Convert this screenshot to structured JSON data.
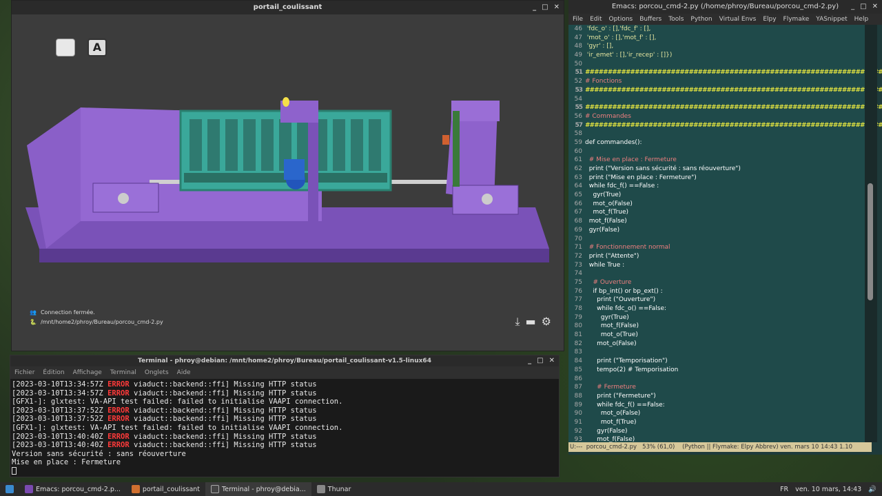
{
  "viewer": {
    "title": "portail_coulissant",
    "status": "Connection fermée.",
    "path": "/mnt/home2/phroy/Bureau/porcou_cmd-2.py",
    "btn_a": "A"
  },
  "emacs": {
    "title": "Emacs: porcou_cmd-2.py (/home/phroy/Bureau/porcou_cmd-2.py)",
    "menu": [
      "File",
      "Edit",
      "Options",
      "Buffers",
      "Tools",
      "Python",
      "Virtual Envs",
      "Elpy",
      "Flymake",
      "YASnippet",
      "Help"
    ],
    "lines": [
      {
        "n": "46",
        "t": " 'fdc_o' : [],'fdc_f' : [],",
        "c": "str"
      },
      {
        "n": "47",
        "t": " 'mot_o' : [],'mot_f' : [],",
        "c": "str"
      },
      {
        "n": "48",
        "t": " 'gyr' : [],",
        "c": "str"
      },
      {
        "n": "49",
        "t": " 'ir_emet' : [],'ir_recep' : []})",
        "c": "str"
      },
      {
        "n": "50",
        "t": "",
        "c": ""
      },
      {
        "n": "51",
        "t": "##################################################################",
        "c": "hash"
      },
      {
        "n": "52",
        "t": "# Fonctions",
        "c": "comment"
      },
      {
        "n": "53",
        "t": "##################################################################",
        "c": "hash"
      },
      {
        "n": "54",
        "t": "",
        "c": ""
      },
      {
        "n": "55",
        "t": "##################################################################",
        "c": "hash"
      },
      {
        "n": "56",
        "t": "# Commandes",
        "c": "comment"
      },
      {
        "n": "57",
        "t": "##################################################################",
        "c": "hash"
      },
      {
        "n": "58",
        "t": "",
        "c": ""
      },
      {
        "n": "59",
        "t": "def commandes():",
        "c": "kw"
      },
      {
        "n": "60",
        "t": "",
        "c": ""
      },
      {
        "n": "61",
        "t": "  # Mise en place : Fermeture",
        "c": "comment"
      },
      {
        "n": "62",
        "t": "  print (\"Version sans sécurité : sans réouverture\")",
        "c": "kw"
      },
      {
        "n": "63",
        "t": "  print (\"Mise en place : Fermeture\")",
        "c": "kw"
      },
      {
        "n": "64",
        "t": "  while fdc_f() ==False :",
        "c": "kw"
      },
      {
        "n": "65",
        "t": "    gyr(True)",
        "c": "kw"
      },
      {
        "n": "66",
        "t": "    mot_o(False)",
        "c": "kw"
      },
      {
        "n": "67",
        "t": "    mot_f(True)",
        "c": "kw"
      },
      {
        "n": "68",
        "t": "  mot_f(False)",
        "c": "kw"
      },
      {
        "n": "69",
        "t": "  gyr(False)",
        "c": "kw"
      },
      {
        "n": "70",
        "t": "",
        "c": ""
      },
      {
        "n": "71",
        "t": "  # Fonctionnement normal",
        "c": "comment"
      },
      {
        "n": "72",
        "t": "  print (\"Attente\")",
        "c": "kw"
      },
      {
        "n": "73",
        "t": "  while True :",
        "c": "kw"
      },
      {
        "n": "74",
        "t": "",
        "c": ""
      },
      {
        "n": "75",
        "t": "    # Ouverture",
        "c": "comment"
      },
      {
        "n": "76",
        "t": "    if bp_int() or bp_ext() :",
        "c": "kw"
      },
      {
        "n": "77",
        "t": "      print (\"Ouverture\")",
        "c": "kw"
      },
      {
        "n": "78",
        "t": "      while fdc_o() ==False:",
        "c": "kw"
      },
      {
        "n": "79",
        "t": "        gyr(True)",
        "c": "kw"
      },
      {
        "n": "80",
        "t": "        mot_f(False)",
        "c": "kw"
      },
      {
        "n": "81",
        "t": "        mot_o(True)",
        "c": "kw"
      },
      {
        "n": "82",
        "t": "      mot_o(False)",
        "c": "kw"
      },
      {
        "n": "83",
        "t": "",
        "c": ""
      },
      {
        "n": "84",
        "t": "      print (\"Temporisation\")",
        "c": "kw"
      },
      {
        "n": "85",
        "t": "      tempo(2) # Temporisation",
        "c": "kw"
      },
      {
        "n": "86",
        "t": "",
        "c": ""
      },
      {
        "n": "87",
        "t": "      # Fermeture",
        "c": "comment"
      },
      {
        "n": "88",
        "t": "      print (\"Fermeture\")",
        "c": "kw"
      },
      {
        "n": "89",
        "t": "      while fdc_f() ==False:",
        "c": "kw"
      },
      {
        "n": "90",
        "t": "        mot_o(False)",
        "c": "kw"
      },
      {
        "n": "91",
        "t": "        mot_f(True)",
        "c": "kw"
      },
      {
        "n": "92",
        "t": "      gyr(False)",
        "c": "kw"
      },
      {
        "n": "93",
        "t": "      mot_f(False)",
        "c": "kw"
      }
    ],
    "modeline": "U:---  porcou_cmd-2.py   53% (61,0)    (Python || Flymake: Elpy Abbrev) ven. mars 10 14:43 1.10"
  },
  "terminal": {
    "title": "Terminal - phroy@debian: /mnt/home2/phroy/Bureau/portail_coulissant-v1.5-linux64",
    "menu": [
      "Fichier",
      "Édition",
      "Affichage",
      "Terminal",
      "Onglets",
      "Aide"
    ],
    "lines": [
      {
        "pre": "[2023-03-10T13:34:57Z ",
        "err": "ERROR",
        "post": " viaduct::backend::ffi] Missing HTTP status"
      },
      {
        "pre": "[2023-03-10T13:34:57Z ",
        "err": "ERROR",
        "post": " viaduct::backend::ffi] Missing HTTP status"
      },
      {
        "pre": "[GFX1-]: glxtest: VA-API test failed: failed to initialise VAAPI connection.",
        "err": "",
        "post": ""
      },
      {
        "pre": "[2023-03-10T13:37:52Z ",
        "err": "ERROR",
        "post": " viaduct::backend::ffi] Missing HTTP status"
      },
      {
        "pre": "[2023-03-10T13:37:52Z ",
        "err": "ERROR",
        "post": " viaduct::backend::ffi] Missing HTTP status"
      },
      {
        "pre": "[GFX1-]: glxtest: VA-API test failed: failed to initialise VAAPI connection.",
        "err": "",
        "post": ""
      },
      {
        "pre": "[2023-03-10T13:40:40Z ",
        "err": "ERROR",
        "post": " viaduct::backend::ffi] Missing HTTP status"
      },
      {
        "pre": "[2023-03-10T13:40:40Z ",
        "err": "ERROR",
        "post": " viaduct::backend::ffi] Missing HTTP status"
      },
      {
        "pre": "Version sans sécurité : sans réouverture",
        "err": "",
        "post": ""
      },
      {
        "pre": "Mise en place : Fermeture",
        "err": "",
        "post": ""
      }
    ]
  },
  "taskbar": {
    "tasks": [
      "Emacs: porcou_cmd-2.p...",
      "portail_coulissant",
      "Terminal - phroy@debia...",
      "Thunar"
    ],
    "clock": "ven. 10 mars, 14:43",
    "lang": "FR"
  }
}
